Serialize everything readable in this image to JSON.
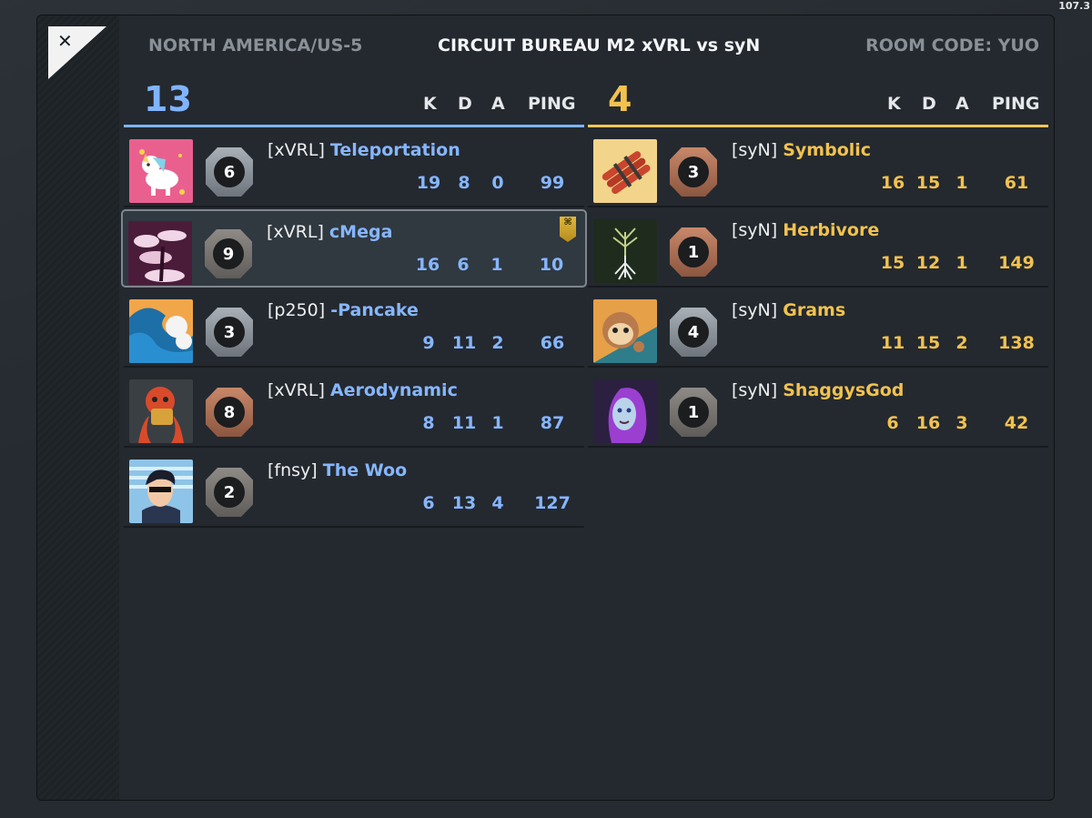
{
  "overlay": {
    "fps": "107.3"
  },
  "header": {
    "region": "NORTH AMERICA/US-5",
    "match": "CIRCUIT BUREAU M2 xVRL vs syN",
    "room_code": "ROOM CODE: YUO",
    "close_symbol": "✕"
  },
  "columns": {
    "k": "K",
    "d": "D",
    "a": "A",
    "ping": "PING"
  },
  "team_blue": {
    "score": "13",
    "color": "#7fb4ff",
    "players": [
      {
        "tag": "[xVRL]",
        "name": "Teleportation",
        "rank": "6",
        "k": "19",
        "d": "8",
        "a": "0",
        "ping": "99",
        "avatar": "unicorn-avatar-icon",
        "rank_style": "silver"
      },
      {
        "tag": "[xVRL]",
        "name": "cMega",
        "rank": "9",
        "k": "16",
        "d": "6",
        "a": "1",
        "ping": "10",
        "avatar": "cloud-tree-avatar-icon",
        "rank_style": "steel",
        "selected": true,
        "badge": "⌘"
      },
      {
        "tag": "[p250]",
        "name": "-Pancake",
        "rank": "3",
        "k": "9",
        "d": "11",
        "a": "2",
        "ping": "66",
        "avatar": "wave-avatar-icon",
        "rank_style": "silver"
      },
      {
        "tag": "[xVRL]",
        "name": "Aerodynamic",
        "rank": "8",
        "k": "8",
        "d": "11",
        "a": "1",
        "ping": "87",
        "avatar": "octopus-avatar-icon",
        "rank_style": "bronze"
      },
      {
        "tag": "[fnsy]",
        "name": "The Woo",
        "rank": "2",
        "k": "6",
        "d": "13",
        "a": "4",
        "ping": "127",
        "avatar": "sunglasses-man-avatar-icon",
        "rank_style": "steel"
      }
    ]
  },
  "team_gold": {
    "score": "4",
    "color": "#f2c24f",
    "players": [
      {
        "tag": "[syN]",
        "name": "Symbolic",
        "rank": "3",
        "k": "16",
        "d": "15",
        "a": "1",
        "ping": "61",
        "avatar": "dynamite-avatar-icon",
        "rank_style": "bronze"
      },
      {
        "tag": "[syN]",
        "name": "Herbivore",
        "rank": "1",
        "k": "15",
        "d": "12",
        "a": "1",
        "ping": "149",
        "avatar": "tree-roots-avatar-icon",
        "rank_style": "bronze"
      },
      {
        "tag": "[syN]",
        "name": "Grams",
        "rank": "4",
        "k": "11",
        "d": "15",
        "a": "2",
        "ping": "138",
        "avatar": "sloth-avatar-icon",
        "rank_style": "silver"
      },
      {
        "tag": "[syN]",
        "name": "ShaggysGod",
        "rank": "1",
        "k": "6",
        "d": "16",
        "a": "3",
        "ping": "42",
        "avatar": "purple-hair-woman-avatar-icon",
        "rank_style": "steel"
      }
    ]
  }
}
